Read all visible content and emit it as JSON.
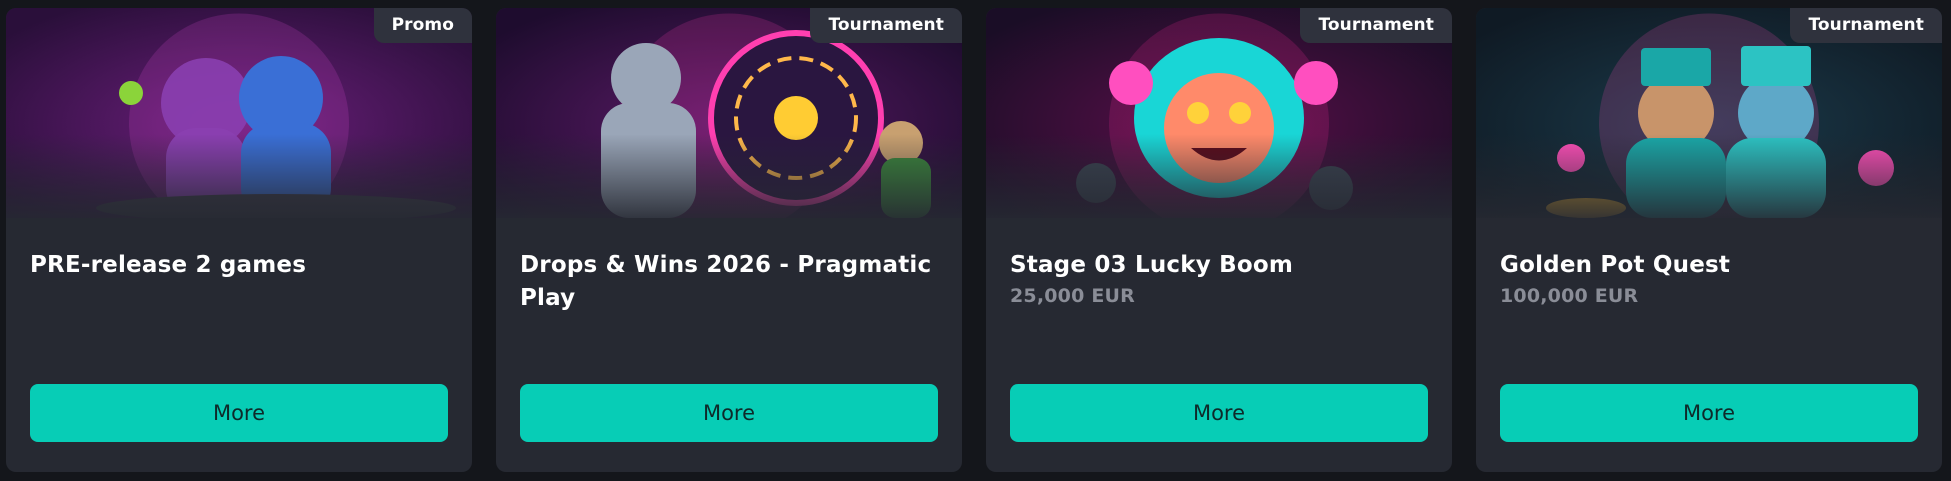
{
  "cards": [
    {
      "badge": "Promo",
      "title": "PRE-release 2 games",
      "prize": "",
      "button": "More",
      "theme": {
        "bg1": "#2a0f3a",
        "bg2": "#6a1e7a",
        "accent": "#e24bd6",
        "figure1": "#8a3fb0",
        "figure2": "#3a6fd6"
      }
    },
    {
      "badge": "Tournament",
      "title": "Drops & Wins 2026 - Pragmatic Play",
      "prize": "",
      "button": "More",
      "theme": {
        "bg1": "#1e0c2e",
        "bg2": "#5a1a66",
        "accent": "#ff3fb0",
        "figure1": "#9aa6b8",
        "figure2": "#4a2f7a"
      }
    },
    {
      "badge": "Tournament",
      "title": "Stage 03 Lucky Boom",
      "prize": "25,000 EUR",
      "button": "More",
      "theme": {
        "bg1": "#1a0d26",
        "bg2": "#5a0f4a",
        "accent": "#ff2e9a",
        "figure1": "#19d6d6",
        "figure2": "#ff4fbf"
      }
    },
    {
      "badge": "Tournament",
      "title": "Golden Pot Quest",
      "prize": "100,000 EUR",
      "button": "More",
      "theme": {
        "bg1": "#0f1a24",
        "bg2": "#1b3a4a",
        "accent": "#ff4fb8",
        "figure1": "#1aa7a7",
        "figure2": "#2cc3c3"
      }
    }
  ]
}
